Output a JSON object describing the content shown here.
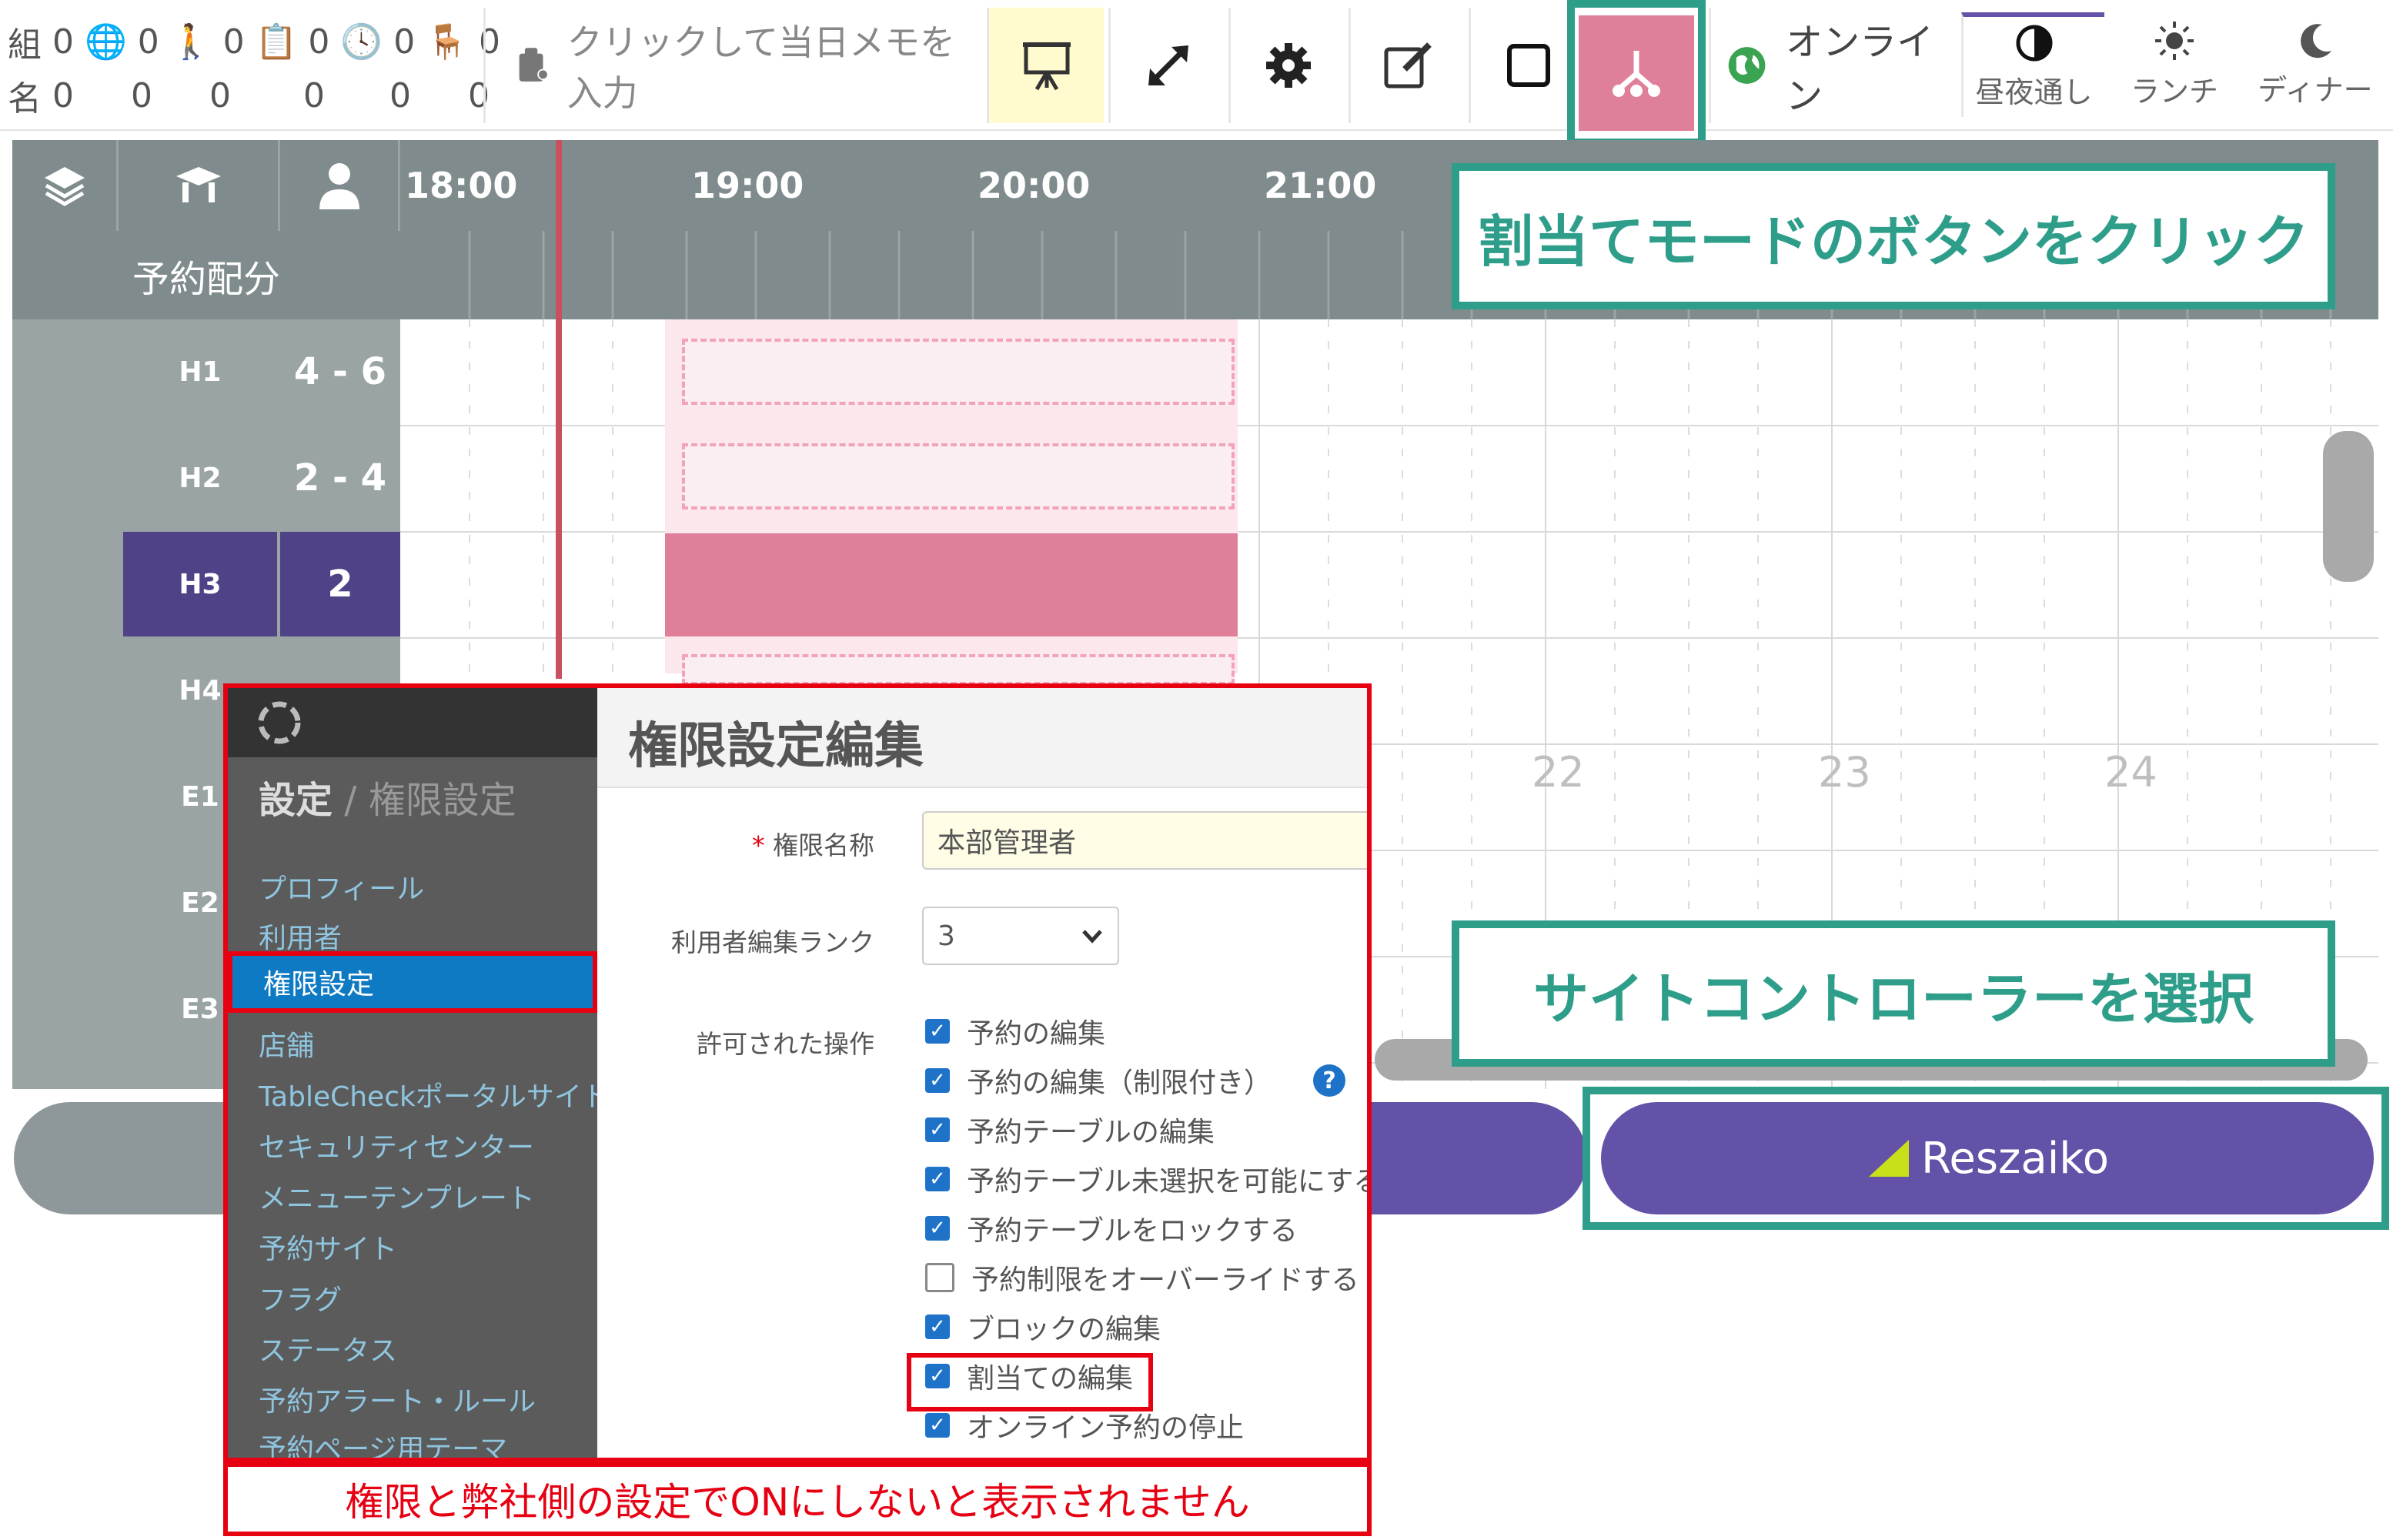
{
  "stats": {
    "row1": [
      {
        "icon": "組",
        "value": "0"
      },
      {
        "icon": "globe-icon",
        "value": "0"
      },
      {
        "icon": "walk-in-icon",
        "value": "0"
      },
      {
        "icon": "clipboard-icon",
        "value": "0"
      },
      {
        "icon": "clock-icon",
        "value": "0"
      },
      {
        "icon": "table-chair-icon",
        "value": "0"
      }
    ],
    "row2_label": "名",
    "row2": [
      "0",
      "0",
      "0",
      "0",
      "0",
      "0"
    ]
  },
  "toolbar": {
    "memo_placeholder": "クリックして当日メモを入力",
    "online_label": "オンライン",
    "modes": [
      "昼夜通し",
      "ランチ",
      "ディナー"
    ]
  },
  "grid": {
    "section_label": "予約配分",
    "times": [
      "18:00",
      "19:00",
      "20:00",
      "21:00"
    ],
    "rows": [
      {
        "name": "H1",
        "capacity": "4 - 6"
      },
      {
        "name": "H2",
        "capacity": "2 - 4"
      },
      {
        "name": "H3",
        "capacity": "2"
      },
      {
        "name": "H4",
        "capacity": ""
      },
      {
        "name": "E1",
        "capacity": ""
      },
      {
        "name": "E2",
        "capacity": ""
      },
      {
        "name": "E3",
        "capacity": ""
      }
    ],
    "day_numbers": [
      "22",
      "23",
      "24"
    ]
  },
  "bottom": {
    "reszaiko_label": "Reszaiko"
  },
  "callouts": {
    "assign_mode": "割当てモードのボタンをクリック",
    "site_controller": "サイトコントローラーを選択",
    "warning": "権限と弊社側の設定でONにしないと表示されません"
  },
  "settings": {
    "breadcrumb_main": "設定",
    "breadcrumb_sep": " / ",
    "breadcrumb_sub": "権限設定",
    "menu": [
      "プロフィール",
      "利用者",
      "権限設定",
      "店舗",
      "TableCheckポータルサイト",
      "セキュリティセンター",
      "メニューテンプレート",
      "予約サイト",
      "フラグ",
      "ステータス",
      "予約アラート・ルール",
      "予約ページ用テーマ"
    ],
    "page_title": "権限設定編集",
    "name_label": "権限名称",
    "name_value": "本部管理者",
    "rank_label": "利用者編集ランク",
    "rank_value": "3",
    "ops_label": "許可された操作",
    "ops": [
      {
        "label": "予約の編集",
        "checked": true
      },
      {
        "label": "予約の編集（制限付き）",
        "checked": true
      },
      {
        "label": "予約テーブルの編集",
        "checked": true
      },
      {
        "label": "予約テーブル未選択を可能にする",
        "checked": true
      },
      {
        "label": "予約テーブルをロックする",
        "checked": true
      },
      {
        "label": "予約制限をオーバーライドする",
        "checked": false
      },
      {
        "label": "ブロックの編集",
        "checked": true
      },
      {
        "label": "割当ての編集",
        "checked": true
      },
      {
        "label": "オンライン予約の停止",
        "checked": true
      }
    ]
  },
  "colors": {
    "teal": "#2e9e8a",
    "red": "#e60012",
    "pink": "#e07f9a",
    "purple": "#6352a8",
    "header_gray": "#7f8b8c"
  }
}
